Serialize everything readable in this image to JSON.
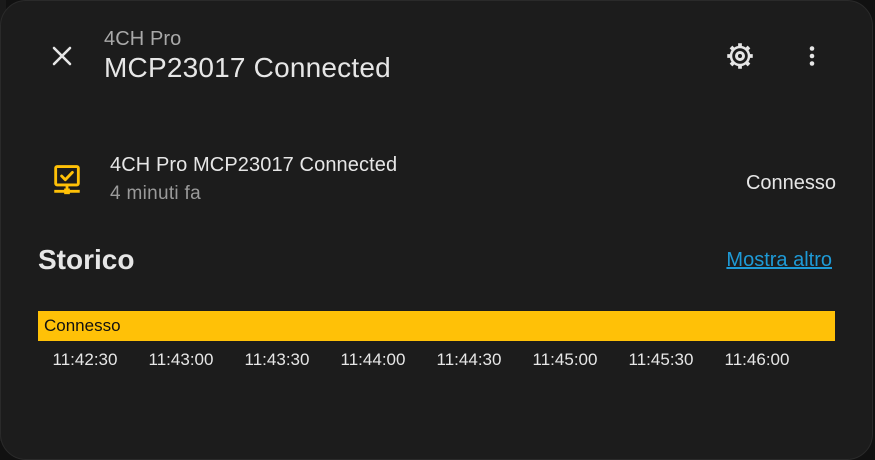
{
  "header": {
    "subtitle": "4CH Pro",
    "title": "MCP23017 Connected"
  },
  "icons": {
    "close": "close-icon",
    "settings": "gear-icon",
    "more": "more-vertical-icon",
    "entity": "network-connected-icon"
  },
  "entity": {
    "name": "4CH Pro MCP23017 Connected",
    "last_changed": "4 minuti fa",
    "state": "Connesso"
  },
  "history": {
    "title": "Storico",
    "show_more": "Mostra altro",
    "bar_label": "Connesso",
    "ticks": [
      "11:42:30",
      "11:43:00",
      "11:43:30",
      "11:44:00",
      "11:44:30",
      "11:45:00",
      "11:45:30",
      "11:46:00"
    ]
  },
  "colors": {
    "accent": "#ffc107",
    "link": "#1e9ad6",
    "background": "#1c1c1c"
  }
}
